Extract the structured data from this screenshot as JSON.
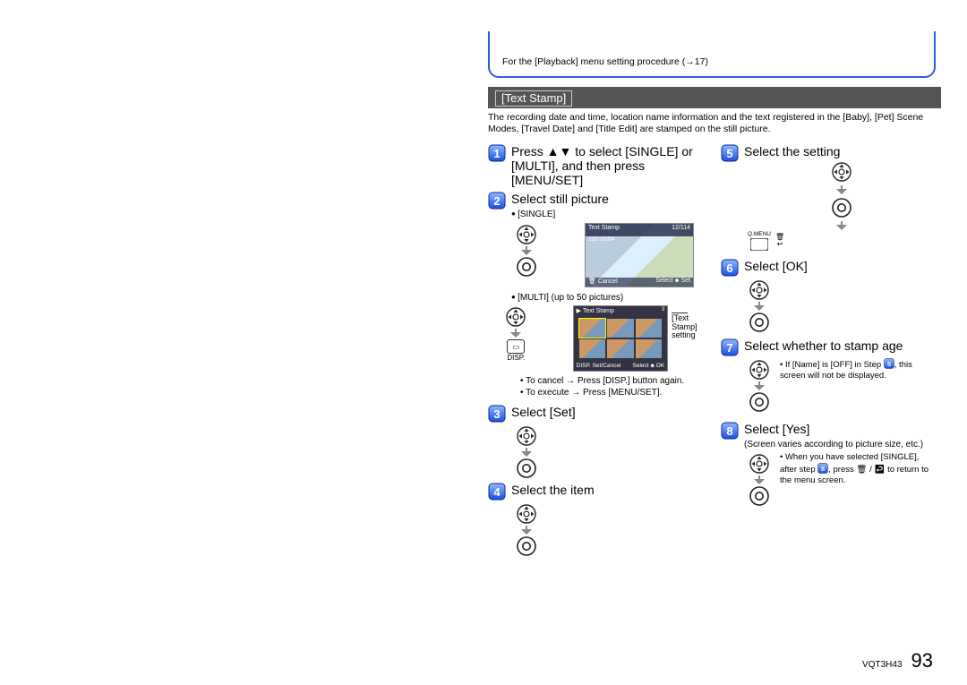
{
  "header_note": "For the [Playback] menu setting procedure (→17)",
  "section_title": "[Text Stamp]",
  "intro": "The recording date and time, location name information and the text registered in the [Baby], [Pet] Scene Modes, [Travel Date] and [Title Edit] are stamped on the still picture.",
  "left": {
    "step1": "Press ▲▼ to select [SINGLE] or [MULTI], and then press [MENU/SET]",
    "step2": "Select still picture",
    "step2_single": "[SINGLE]",
    "step2_multi": "[MULTI] (up to 50 pictures)",
    "step2_multi_callout": "[Text Stamp] setting",
    "step2_cancel": "To cancel → Press [DISP.] button again.",
    "step2_execute": "To execute → Press [MENU/SET].",
    "step3": "Select [Set]",
    "step4": "Select the item",
    "disp_label": "DISP."
  },
  "right": {
    "step5": "Select the setting",
    "qmenu": "Q.MENU",
    "step6": "Select [OK]",
    "step7": "Select whether to stamp age",
    "step7_note_a": "If [Name] is [OFF] in Step ",
    "step7_note_b": ", this screen will not be displayed.",
    "step8": "Select [Yes]",
    "step8_sub": "(Screen varies according to picture size, etc.)",
    "step8_note_a": "When you have selected [SINGLE], after step ",
    "step8_note_b": ", press 🗑 / ↩ to return to the menu screen."
  },
  "thumb_single": {
    "title": "Text Stamp",
    "folder": "100-0084",
    "count": "12/114",
    "cancel": "Cancel",
    "select": "Select",
    "set": "Set"
  },
  "thumb_multi": {
    "title": "Text Stamp",
    "disp": "DISP.",
    "setcancel": "Set/Cancel",
    "select": "Select",
    "ok": "OK"
  },
  "footer_code": "VQT3H43",
  "page_number": "93"
}
